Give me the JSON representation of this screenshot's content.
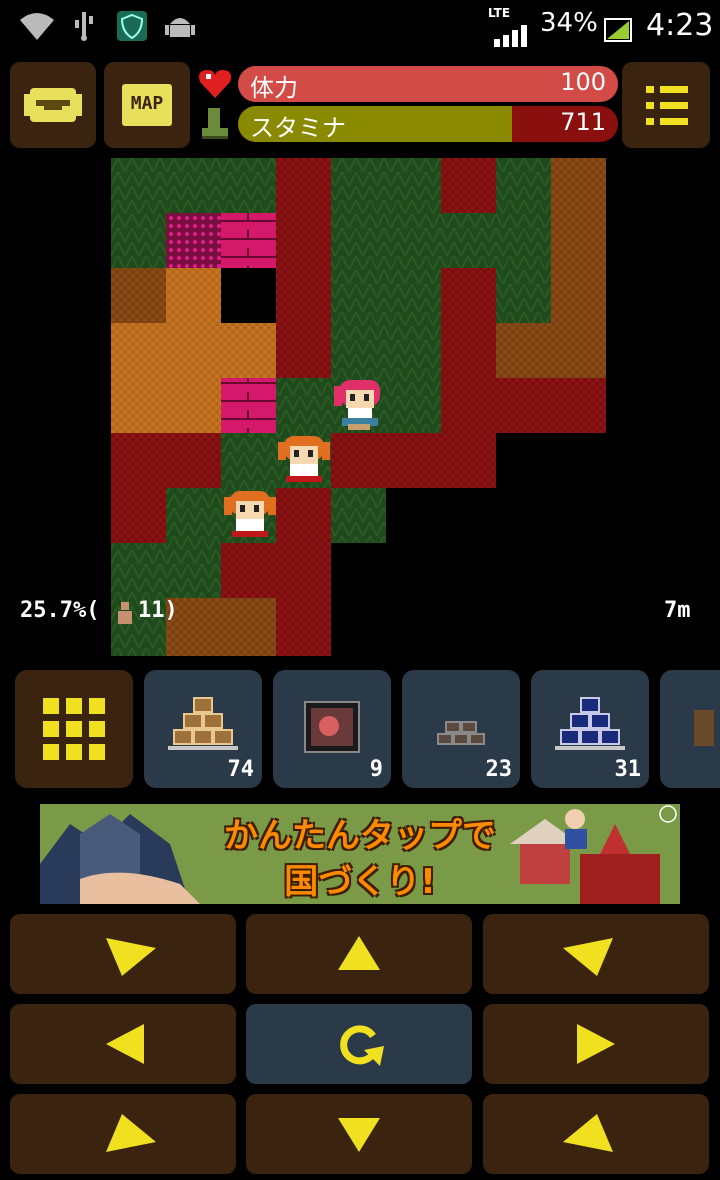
{
  "status_bar": {
    "network": "LTE",
    "battery": "34%",
    "time": "4:23",
    "icons": [
      "wifi-icon",
      "usb-icon",
      "shield-icon",
      "android-icon",
      "signal-icon",
      "battery-icon"
    ]
  },
  "top": {
    "bag_icon": "bag-icon",
    "map_label": "MAP",
    "menu_icon": "menu-icon",
    "hp": {
      "label": "体力",
      "value": "100",
      "fill": 1.0,
      "color": "#d24b47"
    },
    "stamina": {
      "label": "スタミナ",
      "value": "711",
      "fill": 0.72,
      "color": "#8a8a00",
      "bg": "#8a0f0f"
    }
  },
  "game": {
    "progress": "25.7%(",
    "count": "11)",
    "depth": "7m"
  },
  "inventory": [
    {
      "name": "grid-icon",
      "count": ""
    },
    {
      "name": "brown-blocks",
      "count": "74"
    },
    {
      "name": "item-box",
      "count": "9"
    },
    {
      "name": "gray-blocks",
      "count": "23"
    },
    {
      "name": "blue-blocks",
      "count": "31"
    }
  ],
  "ad": {
    "line1": "かんたんタップで",
    "line2": "国づくり!"
  },
  "controls": {
    "center_icon": "rotate-icon",
    "arrows": [
      "down-right-arrow",
      "up-arrow",
      "down-left-arrow",
      "left-arrow",
      "rotate-icon",
      "right-arrow",
      "up-right-arrow",
      "down-arrow",
      "up-left-arrow"
    ]
  }
}
